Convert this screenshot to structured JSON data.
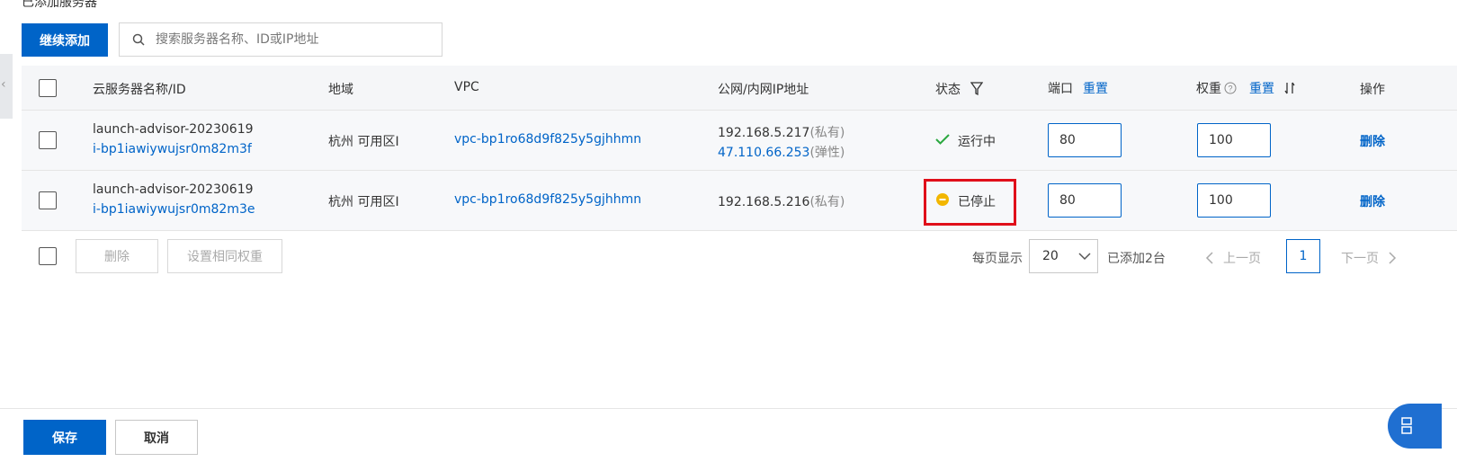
{
  "section_title": "已添加服务器",
  "toolbar": {
    "add_label": "继续添加",
    "search_placeholder": "搜索服务器名称、ID或IP地址"
  },
  "table": {
    "headers": {
      "name": "云服务器名称/ID",
      "region": "地域",
      "vpc": "VPC",
      "ip": "公网/内网IP地址",
      "status": "状态",
      "port": "端口",
      "port_reset": "重置",
      "weight": "权重",
      "weight_reset": "重置",
      "action": "操作"
    },
    "rows": [
      {
        "name": "launch-advisor-20230619",
        "id": "i-bp1iawiywujsr0m82m3f",
        "region": "杭州 可用区I",
        "vpc": "vpc-bp1ro68d9f825y5gjhhmn",
        "ip_private": "192.168.5.217",
        "ip_private_tag": "(私有)",
        "ip_public": "47.110.66.253",
        "ip_public_tag": "(弹性)",
        "status": "运行中",
        "port": "80",
        "weight": "100",
        "action": "删除"
      },
      {
        "name": "launch-advisor-20230619",
        "id": "i-bp1iawiywujsr0m82m3e",
        "region": "杭州 可用区I",
        "vpc": "vpc-bp1ro68d9f825y5gjhhmn",
        "ip_private": "192.168.5.216",
        "ip_private_tag": "(私有)",
        "status": "已停止",
        "port": "80",
        "weight": "100",
        "action": "删除"
      }
    ]
  },
  "footer_bar": {
    "delete_label": "删除",
    "same_weight_label": "设置相同权重",
    "page_size_label": "每页显示",
    "page_size": "20",
    "added_count": "已添加2台",
    "prev_label": "上一页",
    "current_page": "1",
    "next_label": "下一页"
  },
  "bottom_actions": {
    "save_label": "保存",
    "cancel_label": "取消"
  },
  "colors": {
    "primary": "#0064c8",
    "running": "#2aa83f",
    "stopped": "#f2b600",
    "highlight": "#e00f1a"
  },
  "icons": [
    "search-icon",
    "filter-icon",
    "help-icon",
    "sort-icon",
    "check-icon",
    "stopped-icon",
    "chevron-down-icon",
    "chevron-left-icon",
    "chevron-right-icon"
  ]
}
